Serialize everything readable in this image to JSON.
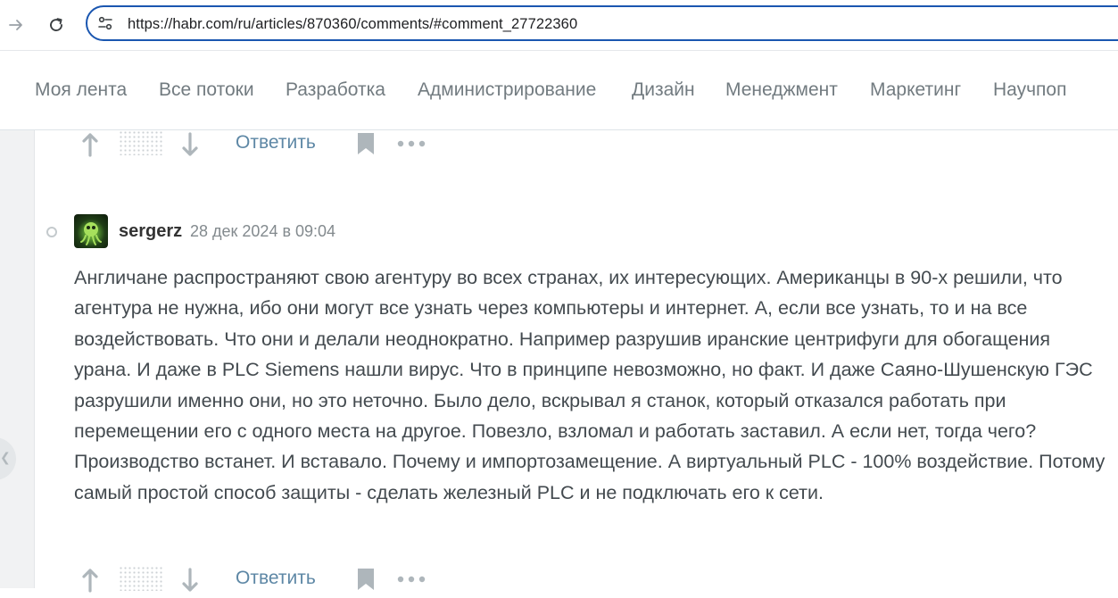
{
  "browser": {
    "url": "https://habr.com/ru/articles/870360/comments/#comment_27722360"
  },
  "site_nav": {
    "items": [
      "Моя лента",
      "Все потоки",
      "Разработка",
      "Администрирование",
      "Дизайн",
      "Менеджмент",
      "Маркетинг",
      "Научпоп"
    ]
  },
  "comment_actions": {
    "reply_label": "Ответить"
  },
  "comment": {
    "author": "sergerz",
    "date": "28 дек 2024 в 09:04",
    "text": "Англичане распространяют свою агентуру во всех странах, их интересующих. Американцы в 90-х решили, что агентура не нужна, ибо они могут все узнать через компьютеры и интернет. А, если все узнать, то и на все воздействовать. Что они и делали неоднократно. Например разрушив иранские центрифуги для обогащения урана. И даже в PLC Siemens нашли вирус. Что в принципе невозможно, но факт. И даже Саяно-Шушенскую ГЭС разрушили именно они, но это неточно. Было дело, вскрывал я станок, который отказался работать при перемещении его с одного места на другое. Повезло, взломал и работать заставил. А если нет, тогда чего? Производство встанет. И вставало. Почему и импортозамещение. А виртуальный PLC - 100% воздействие. Потому самый простой способ защиты - сделать железный PLC и не подключать его к сети."
  },
  "colors": {
    "accent_link": "#5d87a5",
    "address_border": "#1a56b0",
    "nav_text": "#727b80"
  }
}
